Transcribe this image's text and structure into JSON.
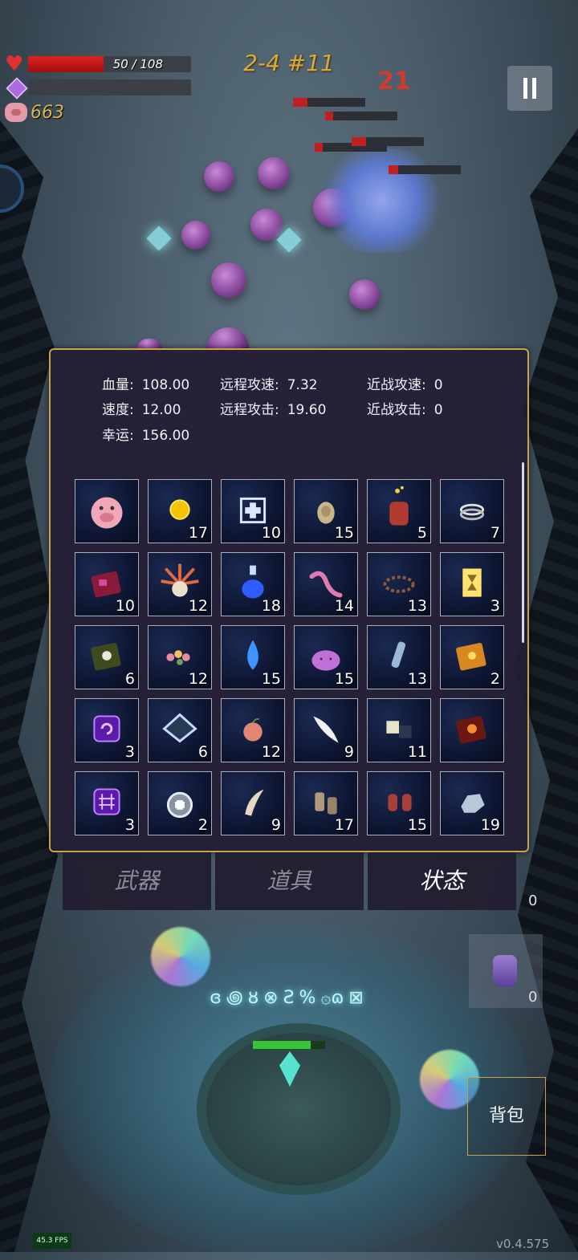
{
  "hud": {
    "hp_text": "50 / 108",
    "hp_fraction": 0.463,
    "mp_fraction": 0,
    "coins": "663",
    "stage": "2-4 #11",
    "damage_popup": "21"
  },
  "stats": {
    "row1": [
      {
        "label": "血量:",
        "value": "108.00"
      },
      {
        "label": "远程攻速:",
        "value": "7.32"
      },
      {
        "label": "近战攻速:",
        "value": "0"
      }
    ],
    "row2": [
      {
        "label": "速度:",
        "value": "12.00"
      },
      {
        "label": "远程攻击:",
        "value": "19.60"
      },
      {
        "label": "近战攻击:",
        "value": "0"
      }
    ],
    "row3": [
      {
        "label": "幸运:",
        "value": "156.00"
      }
    ]
  },
  "inventory": [
    {
      "icon": "piggy-bank-icon",
      "count": ""
    },
    {
      "icon": "gold-coin-icon",
      "count": "17"
    },
    {
      "icon": "medkit-icon",
      "count": "10"
    },
    {
      "icon": "egg-icon",
      "count": "15"
    },
    {
      "icon": "lantern-icon",
      "count": "5"
    },
    {
      "icon": "rings-icon",
      "count": "7"
    },
    {
      "icon": "red-book-icon",
      "count": "10"
    },
    {
      "icon": "spiked-skull-icon",
      "count": "12"
    },
    {
      "icon": "blue-potion-icon",
      "count": "18"
    },
    {
      "icon": "worm-icon",
      "count": "14"
    },
    {
      "icon": "thorn-crown-icon",
      "count": "13"
    },
    {
      "icon": "hourglass-card-icon",
      "count": "3"
    },
    {
      "icon": "skull-book-icon",
      "count": "6"
    },
    {
      "icon": "flower-garland-icon",
      "count": "12"
    },
    {
      "icon": "water-drop-icon",
      "count": "15"
    },
    {
      "icon": "slime-icon",
      "count": "15"
    },
    {
      "icon": "vial-icon",
      "count": "13"
    },
    {
      "icon": "gold-book-icon",
      "count": "2"
    },
    {
      "icon": "spiral-rune-icon",
      "count": "3"
    },
    {
      "icon": "diamond-tile-icon",
      "count": "6"
    },
    {
      "icon": "peach-icon",
      "count": "12"
    },
    {
      "icon": "feather-icon",
      "count": "9"
    },
    {
      "icon": "ore-icon",
      "count": "11"
    },
    {
      "icon": "fire-book-icon",
      "count": ""
    },
    {
      "icon": "hash-rune-icon",
      "count": "3"
    },
    {
      "icon": "silver-medal-icon",
      "count": "2"
    },
    {
      "icon": "fang-icon",
      "count": "9"
    },
    {
      "icon": "boots-icon",
      "count": "17"
    },
    {
      "icon": "gloves-icon",
      "count": "15"
    },
    {
      "icon": "stone-icon",
      "count": "19"
    }
  ],
  "tabs": [
    {
      "label": "武器",
      "active": false
    },
    {
      "label": "道具",
      "active": false
    },
    {
      "label": "状态",
      "active": true
    }
  ],
  "bag_label": "背包",
  "potion_count": "0",
  "side_count": "0",
  "fps": "45.3 FPS",
  "version": "v0.4.575",
  "colors": {
    "panel_border": "#c9a24d",
    "hp": "#e02020",
    "stage": "#d9a93a",
    "coins": "#d7b54a"
  }
}
